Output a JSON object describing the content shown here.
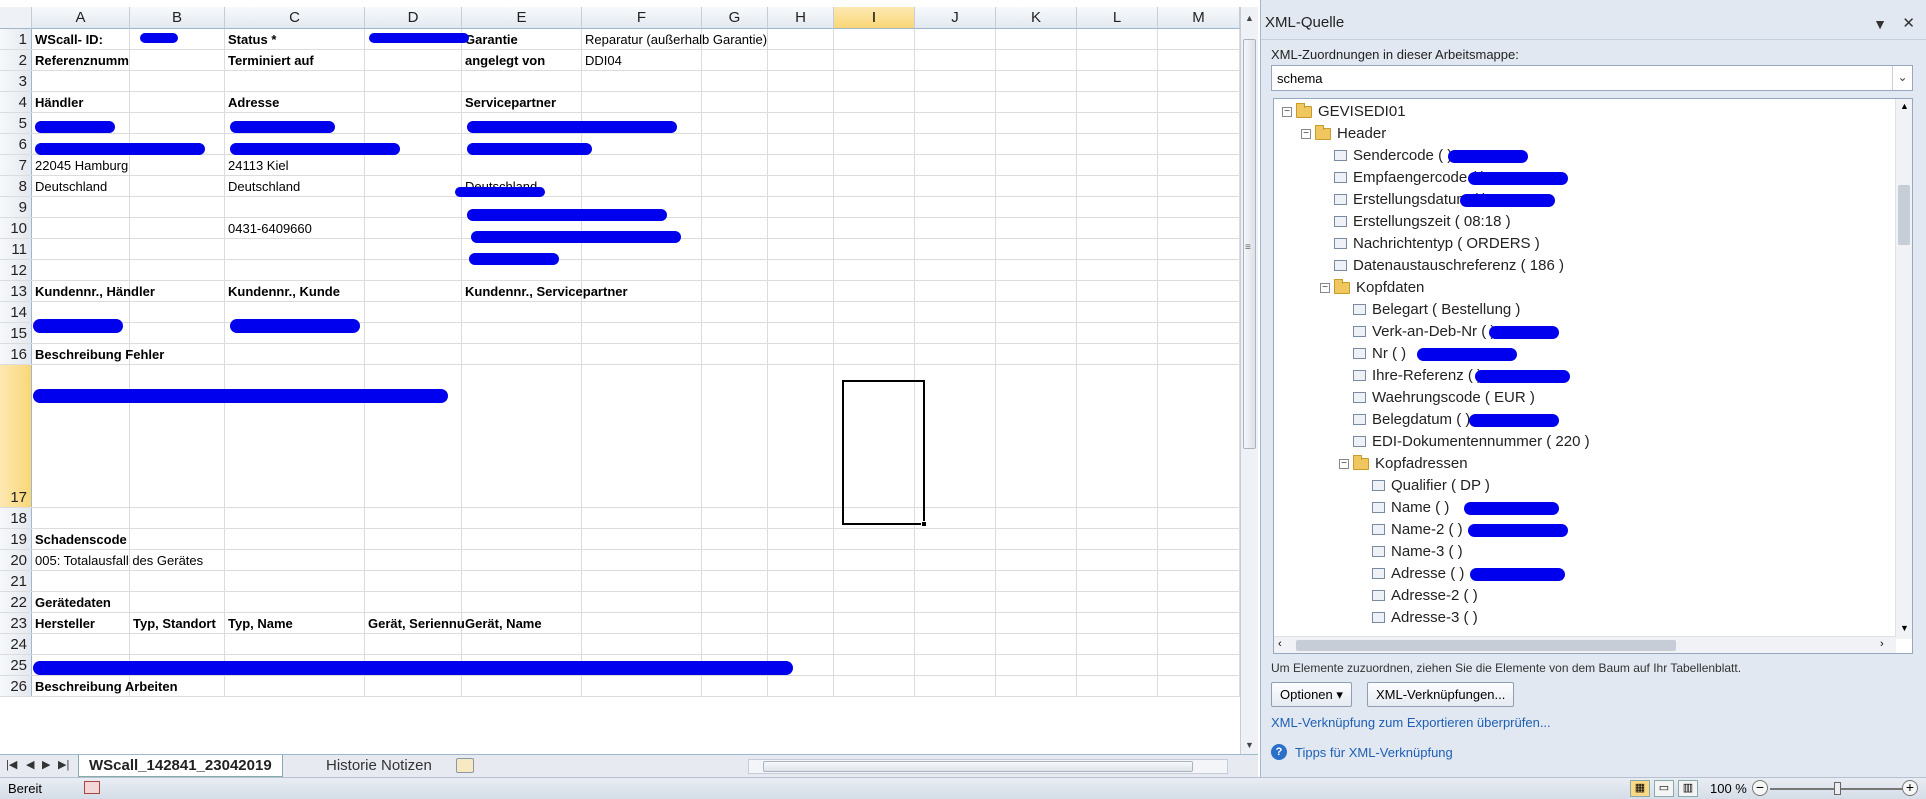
{
  "columns": [
    "A",
    "B",
    "C",
    "D",
    "E",
    "F",
    "G",
    "H",
    "I",
    "J",
    "K",
    "L",
    "M"
  ],
  "rows": [
    {
      "n": "1",
      "cells": {
        "A": "WScall- ID:",
        "C": "Status *",
        "E": "Garantie",
        "F": "Reparatur (außerhalb Garantie)"
      }
    },
    {
      "n": "2",
      "cells": {
        "A": "Referenznumm",
        "C": "Terminiert auf",
        "E": "angelegt von",
        "F": "DDI04"
      }
    },
    {
      "n": "3",
      "cells": {}
    },
    {
      "n": "4",
      "cells": {
        "A": "Händler",
        "C": "Adresse",
        "E": "Servicepartner"
      }
    },
    {
      "n": "5",
      "cells": {}
    },
    {
      "n": "6",
      "cells": {}
    },
    {
      "n": "7",
      "cells": {
        "A": "22045 Hamburg",
        "C": "24113 Kiel"
      }
    },
    {
      "n": "8",
      "cells": {
        "A": "Deutschland",
        "C": "Deutschland",
        "E": "Deutschland"
      }
    },
    {
      "n": "9",
      "cells": {}
    },
    {
      "n": "10",
      "cells": {
        "C": "0431-6409660"
      }
    },
    {
      "n": "11",
      "cells": {}
    },
    {
      "n": "12",
      "cells": {}
    },
    {
      "n": "13",
      "cells": {
        "A": "Kundennr., Händler",
        "C": "Kundennr., Kunde",
        "E": "Kundennr., Servicepartner"
      }
    },
    {
      "n": "14",
      "cells": {}
    },
    {
      "n": "15",
      "cells": {}
    },
    {
      "n": "16",
      "cells": {
        "A": "Beschreibung Fehler"
      }
    },
    {
      "n": "17",
      "cells": {}
    },
    {
      "n": "18",
      "cells": {}
    },
    {
      "n": "19",
      "cells": {
        "A": "Schadenscode"
      }
    },
    {
      "n": "20",
      "cells": {
        "A": "005: Totalausfall des Gerätes"
      }
    },
    {
      "n": "21",
      "cells": {}
    },
    {
      "n": "22",
      "cells": {
        "A": "Gerätedaten"
      }
    },
    {
      "n": "23",
      "cells": {
        "A": "Hersteller",
        "B": "Typ, Standort",
        "C": "Typ, Name",
        "D": "Gerät, Seriennu",
        "E": "Gerät, Name"
      }
    },
    {
      "n": "24",
      "cells": {}
    },
    {
      "n": "25",
      "cells": {}
    },
    {
      "n": "26",
      "cells": {
        "A": "Beschreibung Arbeiten"
      }
    }
  ],
  "sheet_tabs": {
    "active": "WScall_142841_23042019",
    "other": "Historie Notizen"
  },
  "status": {
    "ready": "Bereit",
    "zoom": "100 %"
  },
  "pane": {
    "title": "XML-Quelle",
    "maps_label": "XML-Zuordnungen in dieser Arbeitsmappe:",
    "map_value": "schema",
    "tree": [
      {
        "label": "GEVISEDI01",
        "level": 0,
        "type": "folder",
        "exp": "−"
      },
      {
        "label": "Header",
        "level": 1,
        "type": "folder",
        "exp": "−"
      },
      {
        "label": "Sendercode (                 )",
        "level": 2,
        "type": "leaf"
      },
      {
        "label": "Empfaengercode (                  )",
        "level": 2,
        "type": "leaf"
      },
      {
        "label": "Erstellungsdatum (                  )",
        "level": 2,
        "type": "leaf"
      },
      {
        "label": "Erstellungszeit ( 08:18 )",
        "level": 2,
        "type": "leaf"
      },
      {
        "label": "Nachrichtentyp ( ORDERS )",
        "level": 2,
        "type": "leaf"
      },
      {
        "label": "Datenaustauschreferenz ( 186 )",
        "level": 2,
        "type": "leaf"
      },
      {
        "label": "Kopfdaten",
        "level": 2,
        "type": "folder",
        "exp": "−"
      },
      {
        "label": "Belegart ( Bestellung )",
        "level": 3,
        "type": "leaf"
      },
      {
        "label": "Verk-an-Deb-Nr (               )",
        "level": 3,
        "type": "leaf"
      },
      {
        "label": "Nr (                         )",
        "level": 3,
        "type": "leaf"
      },
      {
        "label": "Ihre-Referenz (                  )",
        "level": 3,
        "type": "leaf"
      },
      {
        "label": "Waehrungscode ( EUR )",
        "level": 3,
        "type": "leaf"
      },
      {
        "label": "Belegdatum (                 )",
        "level": 3,
        "type": "leaf"
      },
      {
        "label": "EDI-Dokumentennummer ( 220 )",
        "level": 3,
        "type": "leaf"
      },
      {
        "label": "Kopfadressen",
        "level": 3,
        "type": "folder",
        "exp": "−"
      },
      {
        "label": "Qualifier ( DP )",
        "level": 4,
        "type": "leaf"
      },
      {
        "label": "Name (                    )",
        "level": 4,
        "type": "leaf"
      },
      {
        "label": "Name-2 (                          )",
        "level": 4,
        "type": "leaf"
      },
      {
        "label": "Name-3 (  )",
        "level": 4,
        "type": "leaf"
      },
      {
        "label": "Adresse (                        )",
        "level": 4,
        "type": "leaf"
      },
      {
        "label": "Adresse-2 (  )",
        "level": 4,
        "type": "leaf"
      },
      {
        "label": "Adresse-3 (  )",
        "level": 4,
        "type": "leaf"
      }
    ],
    "hint": "Um Elemente zuzuordnen, ziehen Sie die Elemente von dem Baum auf Ihr Tabellenblatt.",
    "options_btn": "Optionen",
    "links_btn": "XML-Verknüpfungen...",
    "verify_link": "XML-Verknüpfung zum Exportieren überprüfen...",
    "tips_link": "Tipps für XML-Verknüpfung"
  }
}
